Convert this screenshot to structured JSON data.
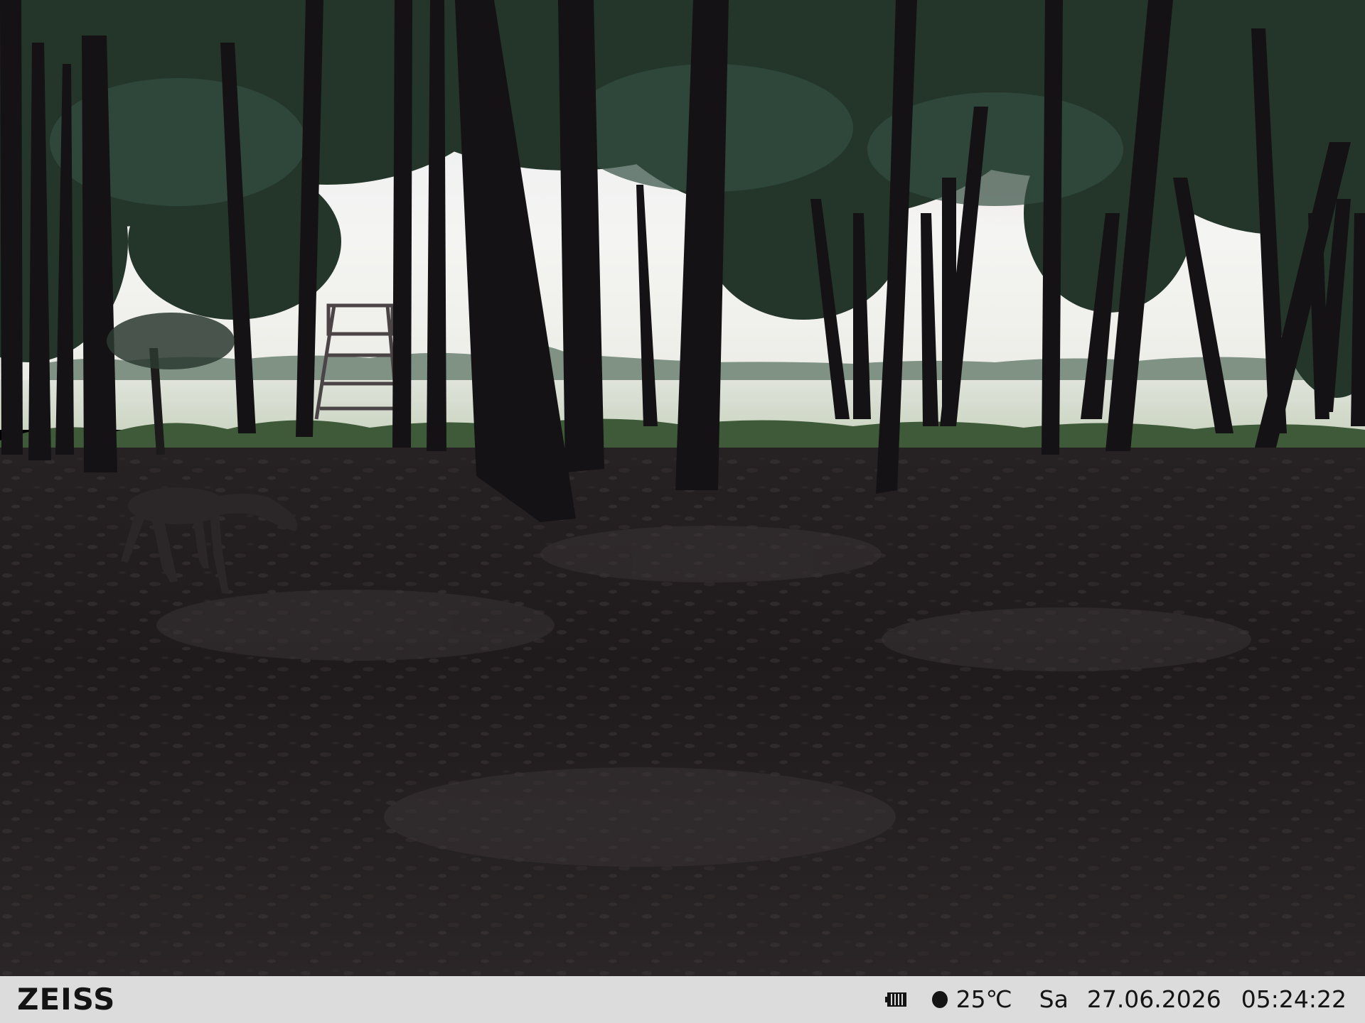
{
  "infobar": {
    "brand": "ZEISS",
    "battery_icon": "battery-full-icon",
    "moon_icon": "moon-phase-icon",
    "temperature": "25℃",
    "weekday": "Sa",
    "date": "27.06.2026",
    "time": "05:24:22"
  },
  "colors": {
    "infobar_background": "#dcdcdc",
    "infobar_text": "#141414",
    "sky": "#f2f2f0",
    "forest_floor": "#1e1a1c"
  }
}
